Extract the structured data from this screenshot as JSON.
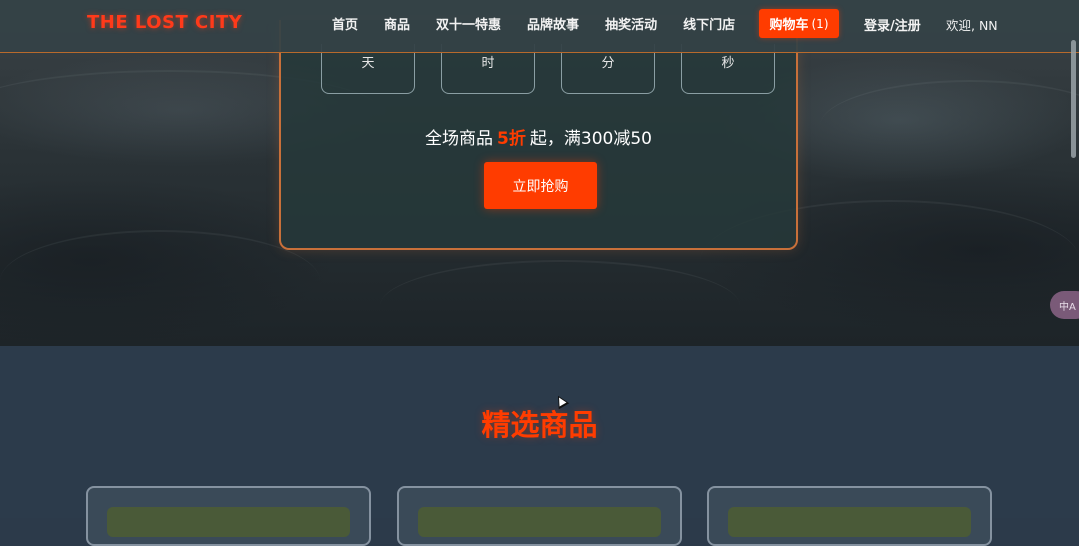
{
  "nav": {
    "logo": "THE LOST CITY",
    "links": [
      "首页",
      "商品",
      "双十一特惠",
      "品牌故事",
      "抽奖活动",
      "线下门店"
    ],
    "cart_label": "购物车",
    "cart_count": "(1)",
    "login": "登录/注册",
    "welcome": "欢迎, NN"
  },
  "promo": {
    "countdown_units": [
      "天",
      "时",
      "分",
      "秒"
    ],
    "text_before": "全场商品",
    "discount": "5折",
    "text_after": "起，满300减50",
    "buy_button": "立即抢购"
  },
  "translate_widget": {
    "label": "中A"
  },
  "featured": {
    "title": "精选商品"
  },
  "colors": {
    "accent": "#ff3c00",
    "border_accent": "#c8703a",
    "section_bg": "#2c3b4b"
  }
}
